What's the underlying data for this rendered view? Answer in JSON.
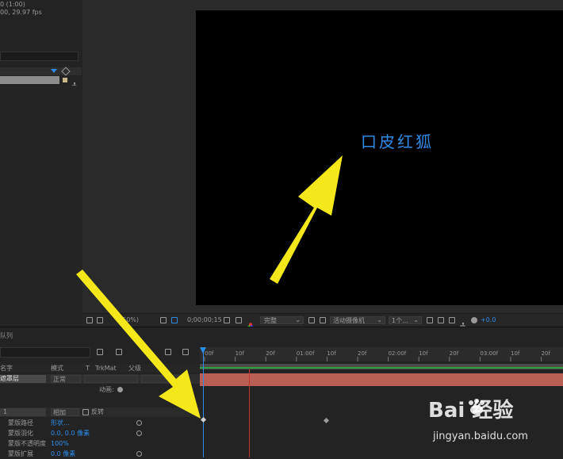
{
  "project": {
    "info_line1": "0 (1:00)",
    "info_line2": "00, 29.97 fps"
  },
  "viewer": {
    "comp_text": "口皮红狐",
    "zoom": "(50%)",
    "timecode": "0;00;00;15",
    "resolution": "完整",
    "camera": "活动摄像机",
    "views": "1个...",
    "exposure": "+0.0"
  },
  "timeline": {
    "panel_label": "队列",
    "col_mode": "模式",
    "col_t": "T",
    "col_trkmat": "TrkMat",
    "col_parent": "父级",
    "col_name": "名字",
    "layer_name": "遮罩层",
    "layer_mode": "正常",
    "anim_label": "动画:",
    "mask_index": "1",
    "mask_mode": "相加",
    "mask_invert": "反转",
    "mask_props": [
      {
        "name": "蒙版路径",
        "value": "形状..."
      },
      {
        "name": "蒙版羽化",
        "value": "0.0, 0.0 像素"
      },
      {
        "name": "蒙版不透明度",
        "value": "100%"
      },
      {
        "name": "蒙版扩展",
        "value": "0.0 像素"
      }
    ],
    "ruler_ticks": [
      "00f",
      "10f",
      "20f",
      "01:00f",
      "10f",
      "20f",
      "02:00f",
      "10f",
      "20f",
      "03:00f",
      "10f",
      "20f"
    ]
  },
  "watermark": {
    "brand": "Bai 经验",
    "url": "jingyan.baidu.com"
  },
  "colors": {
    "accent": "#2d8ceb",
    "layer_bar": "#b95f56",
    "arrow": "#f5e81a"
  }
}
